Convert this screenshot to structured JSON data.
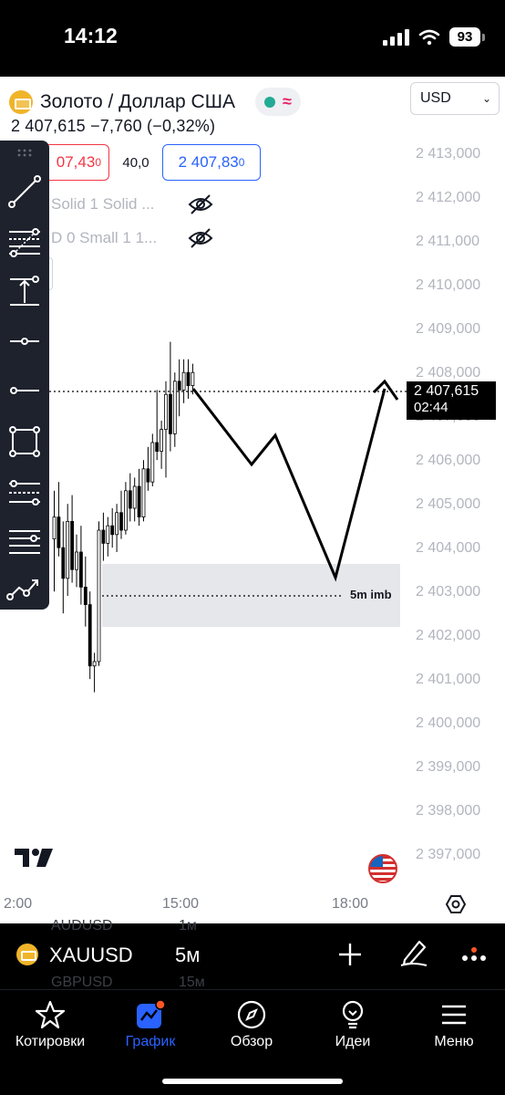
{
  "status_bar": {
    "time": "14:12",
    "battery": "93"
  },
  "header": {
    "symbol_title": "Золото / Доллар США",
    "currency": "USD",
    "price_line": "2 407,615  −7,760 (−0,32%)",
    "sell_price": "07,43",
    "sell_sup": "0",
    "spread": "40,0",
    "buy_price": "2 407,83",
    "buy_sup": "0"
  },
  "indicators": [
    {
      "label": "Solid 1 Solid ..."
    },
    {
      "label": "D 0 Small 1 1..."
    }
  ],
  "y_axis": {
    "labels": [
      "2 413,000",
      "2 412,000",
      "2 411,000",
      "2 410,000",
      "2 409,000",
      "2 408,000",
      "2 407,000",
      "2 406,000",
      "2 405,000",
      "2 404,000",
      "2 403,000",
      "2 402,000",
      "2 401,000",
      "2 400,000",
      "2 399,000",
      "2 398,000",
      "2 397,000"
    ]
  },
  "price_tag": {
    "price": "2 407,615",
    "countdown": "02:44"
  },
  "x_axis": {
    "labels": [
      "2:00",
      "15:00",
      "18:00"
    ]
  },
  "annotation": {
    "label": "5m imb"
  },
  "symbol_bar": {
    "ticker": "XAUUSD",
    "interval": "5м",
    "ghost_above": {
      "ticker": "AUDUSD",
      "interval": "1м"
    },
    "ghost_below": {
      "ticker": "GBPUSD",
      "interval": "15м"
    }
  },
  "nav": {
    "items": [
      {
        "label": "Котировки",
        "icon": "star-icon"
      },
      {
        "label": "График",
        "icon": "chart-icon"
      },
      {
        "label": "Обзор",
        "icon": "compass-icon"
      },
      {
        "label": "Идеи",
        "icon": "bulb-icon"
      },
      {
        "label": "Меню",
        "icon": "menu-icon"
      }
    ],
    "active_index": 1
  },
  "colors": {
    "accent": "#2962ff",
    "sell": "#f23645",
    "badge": "#ff5722"
  },
  "candles": [
    [
      2403.8,
      2404.9,
      2402.6,
      2404.3
    ],
    [
      2404.3,
      2405.1,
      2403.4,
      2403.6
    ],
    [
      2403.6,
      2404.2,
      2402.1,
      2402.9
    ],
    [
      2402.9,
      2404.6,
      2402.5,
      2404.2
    ],
    [
      2404.2,
      2404.8,
      2402.8,
      2403.1
    ],
    [
      2403.1,
      2403.9,
      2402.7,
      2403.5
    ],
    [
      2403.5,
      2404.1,
      2402.3,
      2402.7
    ],
    [
      2402.7,
      2403.4,
      2401.8,
      2402.3
    ],
    [
      2402.3,
      2402.6,
      2400.6,
      2400.9
    ],
    [
      2400.9,
      2401.2,
      2400.3,
      2401.0
    ],
    [
      2401.0,
      2404.2,
      2400.9,
      2404.0
    ],
    [
      2404.0,
      2404.4,
      2403.3,
      2403.7
    ],
    [
      2403.7,
      2404.3,
      2403.4,
      2404.1
    ],
    [
      2404.1,
      2404.5,
      2403.6,
      2403.9
    ],
    [
      2403.9,
      2404.6,
      2403.5,
      2404.4
    ],
    [
      2404.4,
      2404.9,
      2403.8,
      2404.0
    ],
    [
      2404.0,
      2405.1,
      2403.9,
      2404.9
    ],
    [
      2404.9,
      2405.3,
      2404.2,
      2404.5
    ],
    [
      2404.5,
      2405.2,
      2404.2,
      2405.0
    ],
    [
      2405.0,
      2405.4,
      2404.1,
      2404.3
    ],
    [
      2404.3,
      2405.6,
      2404.2,
      2405.4
    ],
    [
      2405.4,
      2405.9,
      2404.9,
      2405.1
    ],
    [
      2405.1,
      2406.2,
      2405.0,
      2406.0
    ],
    [
      2406.0,
      2407.2,
      2405.6,
      2405.8
    ],
    [
      2405.8,
      2406.5,
      2405.4,
      2406.3
    ],
    [
      2406.3,
      2407.4,
      2405.2,
      2407.1
    ],
    [
      2407.1,
      2408.3,
      2405.8,
      2406.2
    ],
    [
      2406.2,
      2407.6,
      2405.9,
      2407.4
    ],
    [
      2407.4,
      2407.9,
      2406.6,
      2407.2
    ],
    [
      2407.2,
      2407.9,
      2406.9,
      2407.6
    ],
    [
      2407.6,
      2407.9,
      2407.0,
      2407.3
    ],
    [
      2407.3,
      2407.8,
      2407.1,
      2407.6
    ]
  ]
}
